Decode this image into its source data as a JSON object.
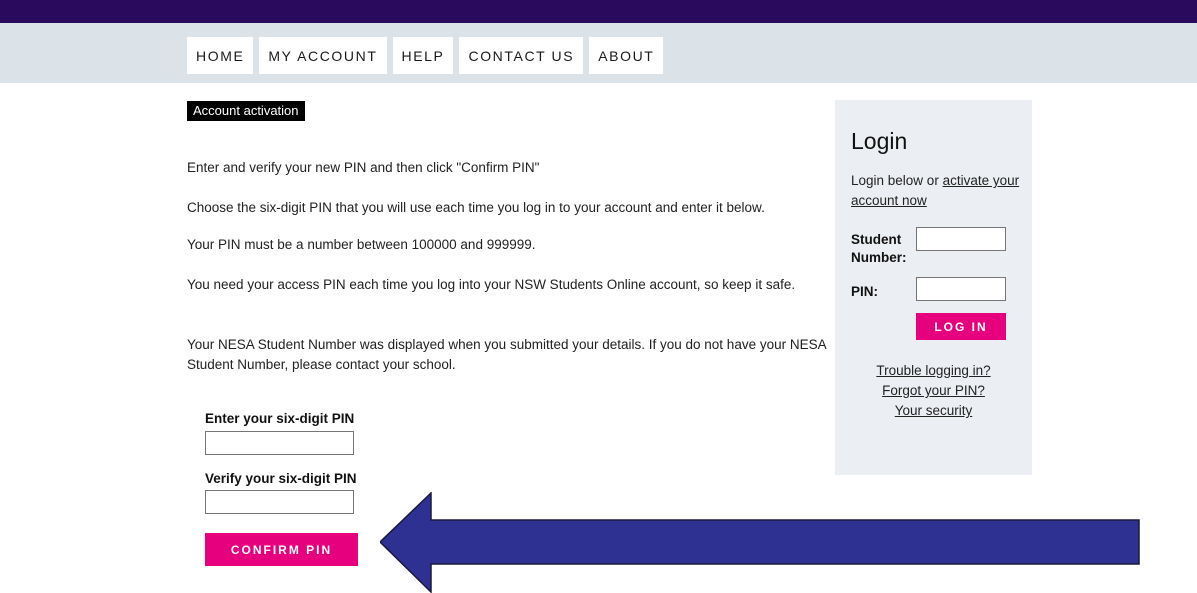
{
  "nav": [
    "HOME",
    "MY ACCOUNT",
    "HELP",
    "CONTACT US",
    "ABOUT"
  ],
  "page": {
    "heading": "Account activation",
    "paragraphs": [
      "Enter and verify your new PIN and then click \"Confirm PIN\"",
      "Choose the six-digit PIN that you will use each time you log in to your account and enter it below.",
      "Your PIN must be a number between 100000 and 999999.",
      "You need your access PIN each time you log into your NSW Students Online account, so keep it safe.",
      "Your NESA Student Number was displayed when you submitted your details. If you do not have your NESA Student Number, please contact your school."
    ],
    "enter_pin_label": "Enter your six-digit PIN",
    "verify_pin_label": "Verify your six-digit PIN",
    "enter_pin_value": "",
    "verify_pin_value": "",
    "confirm_button": "CONFIRM PIN"
  },
  "login": {
    "title": "Login",
    "intro_prefix": "Login below or ",
    "intro_link": "activate your account now",
    "student_number_label": "Student Number:",
    "pin_label": "PIN:",
    "student_number_value": "",
    "pin_value": "",
    "login_button": "LOG IN",
    "links": [
      "Trouble logging in?",
      "Forgot your PIN?",
      "Your security"
    ]
  },
  "colors": {
    "topbar": "#2a0a5c",
    "nav_band": "#dbe2e8",
    "accent": "#e6007e",
    "panel": "#ebeef2",
    "arrow": "#2e3192"
  },
  "annotation": {
    "arrow_icon": "left-arrow-icon"
  }
}
